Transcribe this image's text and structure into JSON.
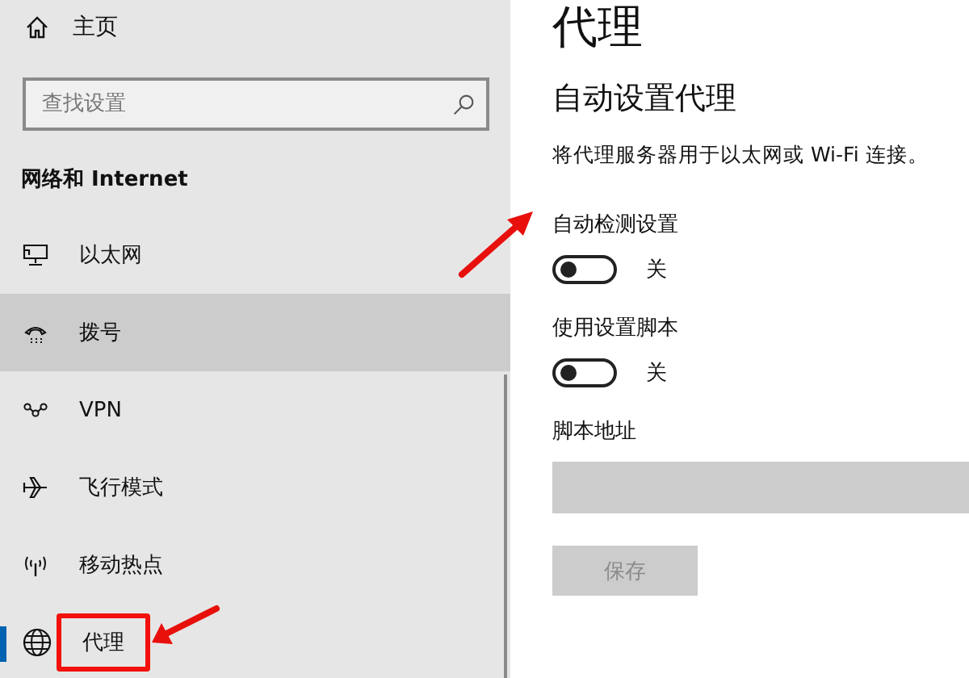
{
  "sidebar": {
    "home": "主页",
    "search": {
      "placeholder": "查找设置"
    },
    "section": "网络和 Internet",
    "items": [
      {
        "label": "以太网",
        "selected": false,
        "hovered": false,
        "highlighted": false
      },
      {
        "label": "拨号",
        "selected": false,
        "hovered": true,
        "highlighted": false
      },
      {
        "label": "VPN",
        "selected": false,
        "hovered": false,
        "highlighted": false
      },
      {
        "label": "飞行模式",
        "selected": false,
        "hovered": false,
        "highlighted": false
      },
      {
        "label": "移动热点",
        "selected": false,
        "hovered": false,
        "highlighted": false
      },
      {
        "label": "代理",
        "selected": true,
        "hovered": false,
        "highlighted": true
      }
    ]
  },
  "page": {
    "title": "代理",
    "section": "自动设置代理",
    "description": "将代理服务器用于以太网或 Wi-Fi 连接。",
    "toggles": [
      {
        "label": "自动检测设置",
        "on": false,
        "state": "关",
        "highlighted": true
      },
      {
        "label": "使用设置脚本",
        "on": false,
        "state": "关"
      }
    ],
    "script_address": {
      "label": "脚本地址",
      "disabled": true
    },
    "save_button": {
      "label": "保存",
      "disabled": true
    }
  }
}
